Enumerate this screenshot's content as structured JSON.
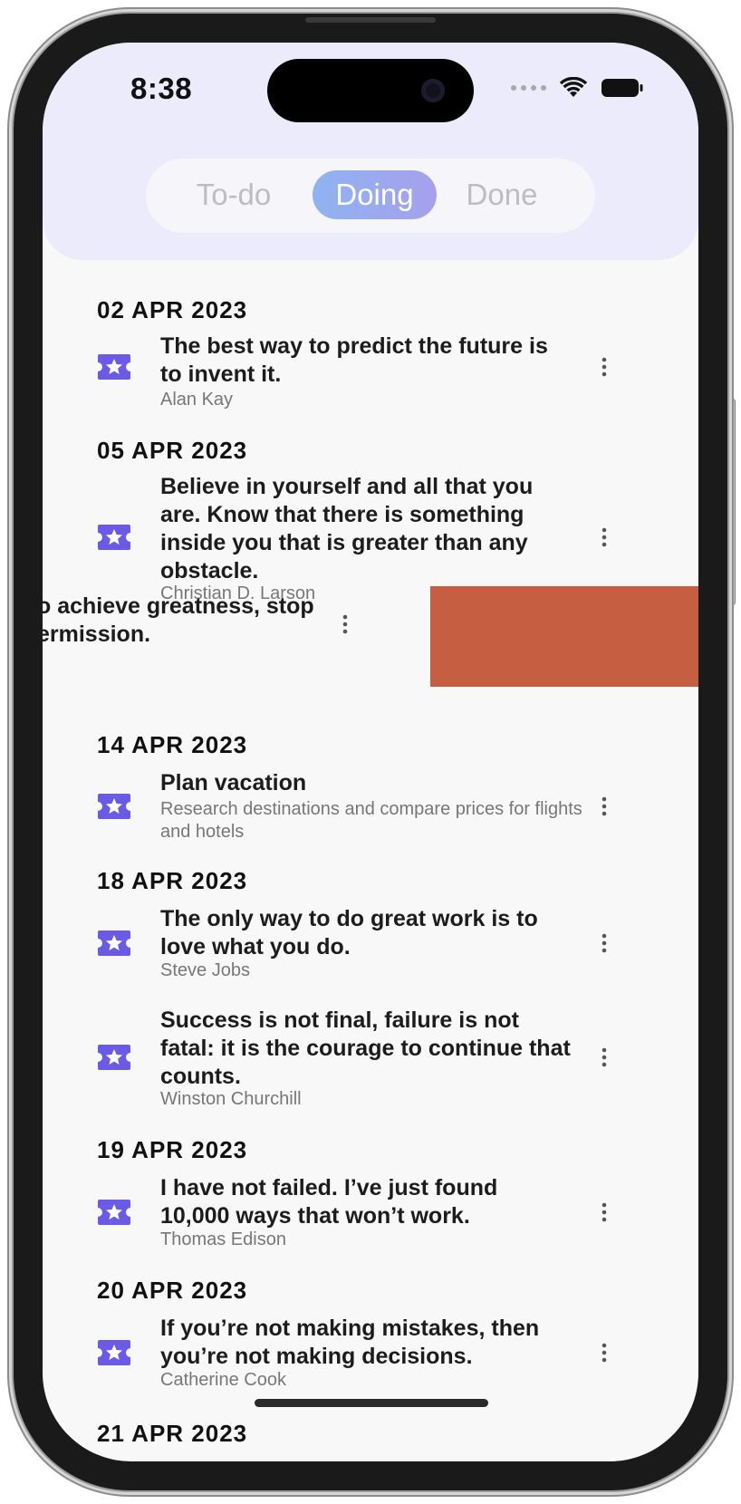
{
  "status_bar": {
    "time": "8:38"
  },
  "tabs": [
    {
      "label": "To-do",
      "selected": false
    },
    {
      "label": "Doing",
      "selected": true
    },
    {
      "label": "Done",
      "selected": false
    }
  ],
  "colors": {
    "accent": "#6b5ae6",
    "header_bg": "#ecebfb",
    "swipe_action": "#c65f42"
  },
  "groups": [
    {
      "date": "02 APR 2023",
      "items": [
        {
          "title": "The best way to predict the future is to invent it.",
          "subtitle": "Alan Kay",
          "icon": "star-ticket-icon"
        }
      ]
    },
    {
      "date": "05 APR 2023",
      "items": [
        {
          "title": "Believe in yourself and all that you are. Know that there is something inside you that is greater than any obstacle.",
          "subtitle": "Christian D. Larson",
          "icon": "star-ticket-icon"
        }
      ]
    }
  ],
  "swiped_item": {
    "title_visible": "o achieve greatness, stop\nermission."
  },
  "groups_after": [
    {
      "date": "14 APR 2023",
      "items": [
        {
          "title": "Plan vacation",
          "subtitle": "Research destinations and compare prices for flights and hotels",
          "icon": "star-ticket-icon"
        }
      ]
    },
    {
      "date": "18 APR 2023",
      "items": [
        {
          "title": "The only way to do great work is to love what you do.",
          "subtitle": "Steve Jobs",
          "icon": "star-ticket-icon"
        },
        {
          "title": "Success is not final, failure is not fatal: it is the courage to continue that counts.",
          "subtitle": "Winston Churchill",
          "icon": "star-ticket-icon"
        }
      ]
    },
    {
      "date": "19 APR 2023",
      "items": [
        {
          "title": "I have not failed. I’ve just found 10,000 ways that won’t work.",
          "subtitle": "Thomas Edison",
          "icon": "star-ticket-icon"
        }
      ]
    },
    {
      "date": "20 APR 2023",
      "items": [
        {
          "title": "If you’re not making mistakes, then you’re not making decisions.",
          "subtitle": "Catherine Cook",
          "icon": "star-ticket-icon"
        }
      ]
    }
  ],
  "partial_date": "21 APR 2023"
}
